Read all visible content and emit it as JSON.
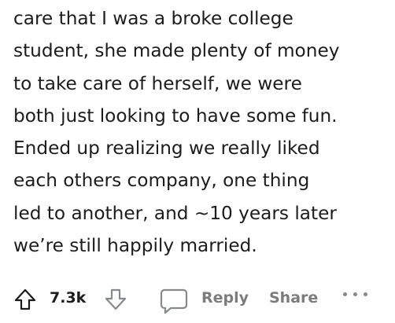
{
  "comment": {
    "lines": [
      "care that I was a broke college",
      "student, she made plenty of money",
      "to take care of herself, we were",
      "both just looking to have some fun.",
      "Ended up realizing we really liked",
      "each others company, one thing",
      "led to another, and ~10 years later",
      "we’re still happily married."
    ]
  },
  "actions": {
    "upvote_icon": "arrow-up-outline-icon",
    "score": "7.3k",
    "downvote_icon": "arrow-down-outline-icon",
    "reply_icon": "speech-bubble-icon",
    "reply_label": "Reply",
    "share_label": "Share",
    "more_icon": "ellipsis-icon"
  },
  "colors": {
    "text": "#1c1c1c",
    "muted": "#7c7c7c",
    "icon": "#878a8c"
  }
}
